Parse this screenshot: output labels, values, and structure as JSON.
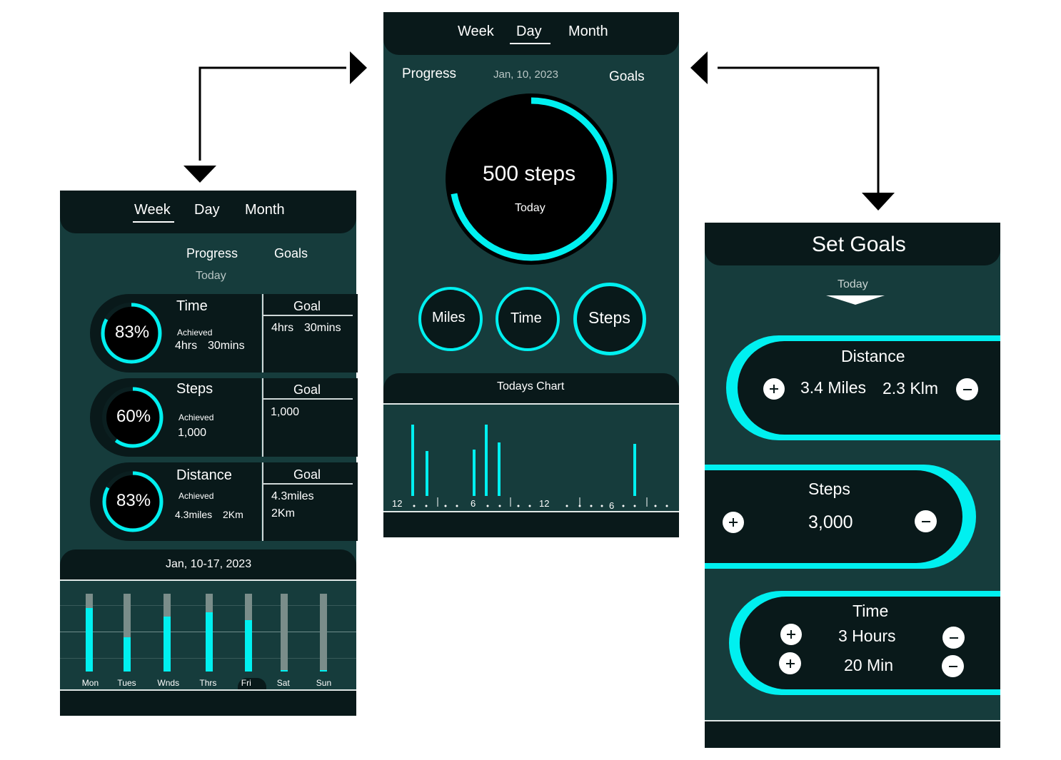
{
  "colors": {
    "accent": "#00f0f0",
    "dark": "#09191a",
    "panel": "#163c3c",
    "muted_bar": "#7a8d8a"
  },
  "tabs": {
    "week": "Week",
    "day": "Day",
    "month": "Month"
  },
  "week_screen": {
    "progress_label": "Progress",
    "goals_label": "Goals",
    "today_label": "Today",
    "goal_header": "Goal",
    "achieved_label": "Achieved",
    "cards": [
      {
        "title": "Time",
        "percent": "83%",
        "progress": 0.83,
        "achieved_a": "4hrs",
        "achieved_b": "30mins",
        "goal_a": "4hrs",
        "goal_b": "30mins"
      },
      {
        "title": "Steps",
        "percent": "60%",
        "progress": 0.6,
        "achieved_a": "1,000",
        "goal_a": "1,000"
      },
      {
        "title": "Distance",
        "percent": "83%",
        "progress": 0.83,
        "achieved_a": "4.3miles",
        "achieved_b": "2Km",
        "goal_a": "4.3miles",
        "goal_b": "2Km"
      }
    ],
    "date_range": "Jan, 10-17, 2023",
    "weekly_chart": {
      "type": "bar",
      "categories": [
        "Mon",
        "Tues",
        "Wnds",
        "Thrs",
        "Fri",
        "Sat",
        "Sun"
      ],
      "progress": [
        0.82,
        0.44,
        0.71,
        0.76,
        0.66,
        0.02,
        0.02
      ],
      "selected": "Fri"
    }
  },
  "day_screen": {
    "progress_label": "Progress",
    "date": "Jan, 10, 2023",
    "goals_label": "Goals",
    "main_value": "500 steps",
    "main_sub": "Today",
    "main_progress": 0.72,
    "metric_buttons": [
      "Miles",
      "Time",
      "Steps"
    ],
    "chart_title": "Todays Chart",
    "axis_labels": [
      "12",
      "6",
      "12",
      "6"
    ],
    "bar_heights": [
      1.0,
      0.63,
      0.65,
      1.0,
      0.75,
      0.73
    ]
  },
  "goals_screen": {
    "title": "Set Goals",
    "today_label": "Today",
    "distance": {
      "title": "Distance",
      "miles": "3.4 Miles",
      "klm": "2.3 Klm"
    },
    "steps": {
      "title": "Steps",
      "value": "3,000"
    },
    "time": {
      "title": "Time",
      "hours": "3 Hours",
      "minutes": "20 Min"
    }
  }
}
